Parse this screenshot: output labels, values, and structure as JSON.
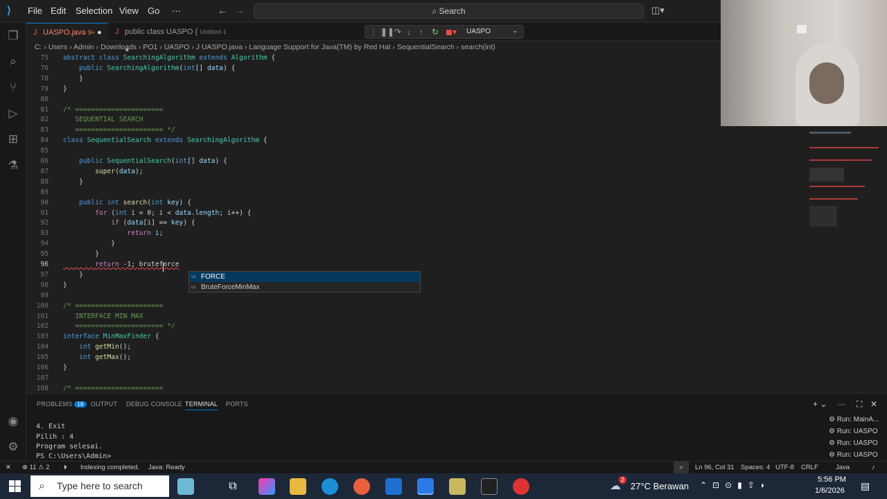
{
  "menu": [
    "File",
    "Edit",
    "Selection",
    "View",
    "Go",
    "···"
  ],
  "search": {
    "label": "Search"
  },
  "debug": {
    "config": "UASPO"
  },
  "tabs": [
    {
      "label": "UASPO.java",
      "badge": "9+",
      "active": true
    },
    {
      "label": "public class UASPO {",
      "hint": "Untitled-1",
      "active": false
    }
  ],
  "breadcrumb": "C: › Users › Admin › Downloads › PO1 › UASPO › J UASPO.java › Language Support for Java(TM) by Red Hat › SequentialSearch › search(int)",
  "code": [
    {
      "n": "75",
      "t": "abstract class SearchingAlgorithm extends Algorithm {"
    },
    {
      "n": "76",
      "t": "    public SearchingAlgorithm(int[] data) {"
    },
    {
      "n": "78",
      "t": "    }"
    },
    {
      "n": "79",
      "t": "}"
    },
    {
      "n": "80",
      "t": ""
    },
    {
      "n": "81",
      "t": "/* ======================"
    },
    {
      "n": "82",
      "t": "   SEQUENTIAL SEARCH"
    },
    {
      "n": "83",
      "t": "   ====================== */"
    },
    {
      "n": "84",
      "t": "class SequentialSearch extends SearchingAlgorithm {"
    },
    {
      "n": "85",
      "t": ""
    },
    {
      "n": "86",
      "t": "    public SequentialSearch(int[] data) {"
    },
    {
      "n": "87",
      "t": "        super(data);"
    },
    {
      "n": "88",
      "t": "    }"
    },
    {
      "n": "89",
      "t": ""
    },
    {
      "n": "90",
      "t": "    public int search(int key) {"
    },
    {
      "n": "91",
      "t": "        for (int i = 0; i < data.length; i++) {"
    },
    {
      "n": "92",
      "t": "            if (data[i] == key) {"
    },
    {
      "n": "93",
      "t": "                return i;"
    },
    {
      "n": "94",
      "t": "            }"
    },
    {
      "n": "95",
      "t": "        }"
    },
    {
      "n": "96",
      "t": "        return -1; bruteforce"
    },
    {
      "n": "97",
      "t": "    }"
    },
    {
      "n": "98",
      "t": "}"
    },
    {
      "n": "99",
      "t": ""
    },
    {
      "n": "100",
      "t": "/* ======================"
    },
    {
      "n": "101",
      "t": "   INTERFACE MIN MAX"
    },
    {
      "n": "102",
      "t": "   ====================== */"
    },
    {
      "n": "103",
      "t": "interface MinMaxFinder {"
    },
    {
      "n": "104",
      "t": "    int getMin();"
    },
    {
      "n": "105",
      "t": "    int getMax();"
    },
    {
      "n": "106",
      "t": "}"
    },
    {
      "n": "107",
      "t": ""
    },
    {
      "n": "108",
      "t": "/* ======================"
    }
  ],
  "suggestions": [
    "FORCE",
    "BruteForceMinMax"
  ],
  "panel": {
    "tabs": [
      "PROBLEMS",
      "OUTPUT",
      "DEBUG CONSOLE",
      "TERMINAL",
      "PORTS"
    ],
    "problems_count": "18",
    "terminal": [
      "4. Exit",
      "Pilih : 4",
      "Program selesai.",
      "PS C:\\Users\\Admin> "
    ],
    "runs": [
      "Run: MainA...",
      "Run: UASPO",
      "Run: UASPO",
      "Run: UASPO"
    ]
  },
  "status": {
    "errors": "11",
    "warnings": "2",
    "indexing": "Indexing completed.",
    "java": "Java: Ready",
    "position": "Ln 96, Col 31",
    "spaces": "Spaces: 4",
    "encoding": "UTF-8",
    "eol": "CRLF",
    "lang": "Java"
  },
  "taskbar": {
    "search_placeholder": "Type here to search",
    "weather": "27°C  Berawan",
    "weather_badge": "2",
    "time": "5:56 PM",
    "date": "1/6/2026"
  },
  "colors": {
    "accent": "#0078d4",
    "keyword": "#569cd6",
    "type": "#4ec9b0"
  }
}
